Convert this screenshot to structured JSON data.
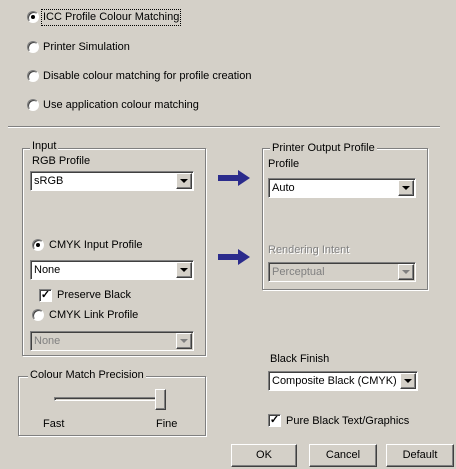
{
  "matching_options": [
    {
      "label": "ICC Profile Colour Matching",
      "selected": true
    },
    {
      "label": "Printer Simulation",
      "selected": false
    },
    {
      "label": "Disable colour matching for profile creation",
      "selected": false
    },
    {
      "label": "Use application colour matching",
      "selected": false
    }
  ],
  "input_group": {
    "legend": "Input",
    "rgb_profile_label": "RGB Profile",
    "rgb_profile_value": "sRGB",
    "cmyk_input_label": "CMYK Input Profile",
    "cmyk_input_selected": true,
    "cmyk_input_value": "None",
    "preserve_black_label": "Preserve Black",
    "preserve_black_checked": true,
    "cmyk_link_label": "CMYK Link Profile",
    "cmyk_link_selected": false,
    "cmyk_link_value": "None"
  },
  "output_group": {
    "legend": "Printer Output Profile",
    "profile_label": "Profile",
    "profile_value": "Auto",
    "rendering_intent_label": "Rendering Intent",
    "rendering_intent_value": "Perceptual"
  },
  "precision_group": {
    "legend": "Colour Match Precision",
    "fast_label": "Fast",
    "fine_label": "Fine",
    "slider_level": 1.0
  },
  "black_finish": {
    "label": "Black Finish",
    "value": "Composite Black (CMYK)"
  },
  "pure_black": {
    "label": "Pure Black Text/Graphics",
    "checked": true
  },
  "buttons": {
    "ok": "OK",
    "cancel": "Cancel",
    "default": "Default"
  },
  "colors": {
    "dialog_bg": "#d4d0c8",
    "arrow_blue": "#2b2b8c"
  },
  "icons": {
    "arrow": "right-arrow-icon",
    "check": "checkmark-icon"
  }
}
